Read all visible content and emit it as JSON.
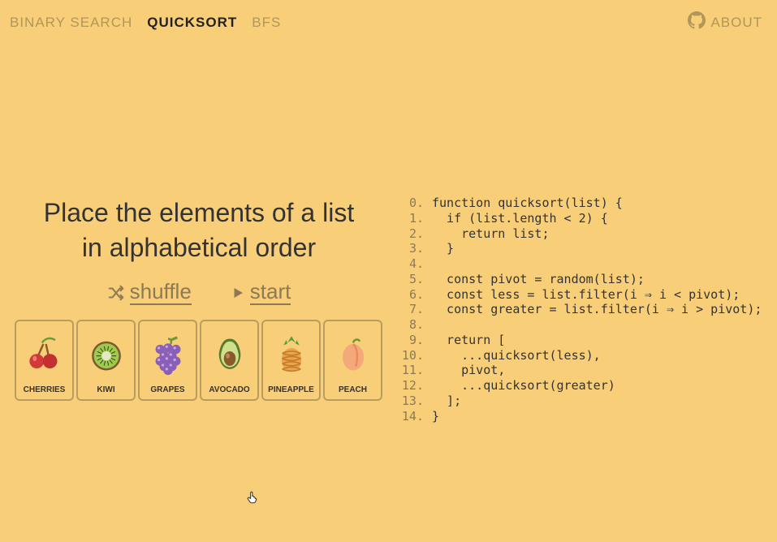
{
  "nav": {
    "tabs": [
      {
        "label": "BINARY SEARCH",
        "active": false
      },
      {
        "label": "QUICKSORT",
        "active": true
      },
      {
        "label": "BFS",
        "active": false
      }
    ],
    "about": "ABOUT"
  },
  "headline_l1": "Place the elements of a list",
  "headline_l2": "in alphabetical order",
  "controls": {
    "shuffle": "shuffle",
    "start": "start"
  },
  "cards": [
    {
      "label": "CHERRIES",
      "icon": "cherries"
    },
    {
      "label": "KIWI",
      "icon": "kiwi"
    },
    {
      "label": "GRAPES",
      "icon": "grapes"
    },
    {
      "label": "AVOCADO",
      "icon": "avocado"
    },
    {
      "label": "PINEAPPLE",
      "icon": "pineapple"
    },
    {
      "label": "PEACH",
      "icon": "peach"
    }
  ],
  "code": [
    "function quicksort(list) {",
    "  if (list.length < 2) {",
    "    return list;",
    "  }",
    "",
    "  const pivot = random(list);",
    "  const less = list.filter(i ⇒ i < pivot);",
    "  const greater = list.filter(i ⇒ i > pivot);",
    "",
    "  return [",
    "    ...quicksort(less),",
    "    pivot,",
    "    ...quicksort(greater)",
    "  ];",
    "}"
  ]
}
